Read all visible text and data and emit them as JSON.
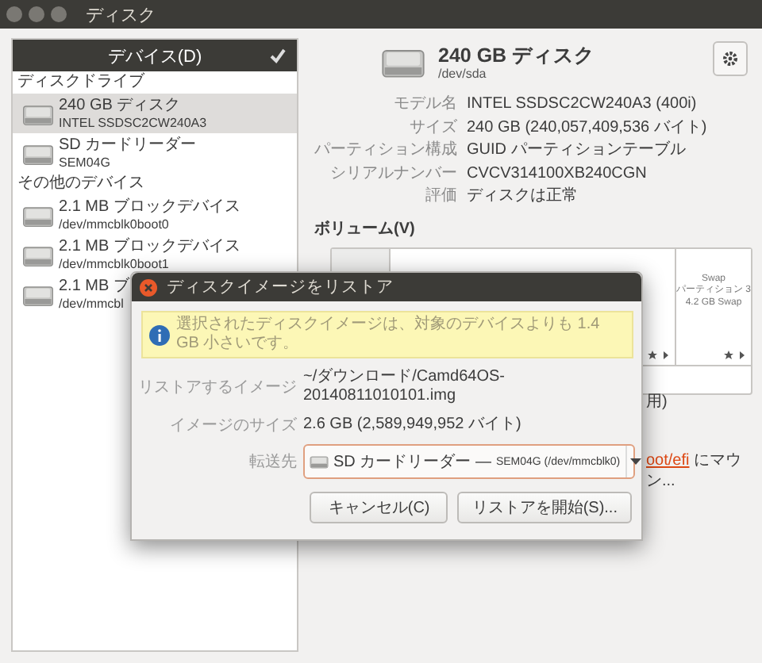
{
  "window": {
    "title": "ディスク"
  },
  "sidebar": {
    "title": "デバイス(D)",
    "groups": [
      {
        "heading": "ディスクドライブ",
        "items": [
          {
            "name": "240 GB ディスク",
            "detail": "INTEL SSDSC2CW240A3",
            "selected": true
          },
          {
            "name": "SD カードリーダー",
            "detail": "SEM04G",
            "selected": false
          }
        ]
      },
      {
        "heading": "その他のデバイス",
        "items": [
          {
            "name": "2.1 MB ブロックデバイス",
            "detail": "/dev/mmcblk0boot0",
            "selected": false
          },
          {
            "name": "2.1 MB ブロックデバイス",
            "detail": "/dev/mmcblk0boot1",
            "selected": false
          },
          {
            "name": "2.1 MB ブ",
            "detail": "/dev/mmcbl",
            "selected": false
          }
        ]
      }
    ]
  },
  "disk": {
    "title": "240 GB ディスク",
    "device": "/dev/sda",
    "properties": [
      {
        "label": "モデル名",
        "value": "INTEL SSDSC2CW240A3 (400i)"
      },
      {
        "label": "サイズ",
        "value": "240 GB (240,057,409,536 バイト)"
      },
      {
        "label": "パーティション構成",
        "value": "GUID パーティションテーブル"
      },
      {
        "label": "シリアルナンバー",
        "value": "CVCV314100XB240CGN"
      },
      {
        "label": "評価",
        "value": "ディスクは正常"
      }
    ]
  },
  "volumes": {
    "title": "ボリューム(V)",
    "segments": [
      {
        "kind": "shaded"
      },
      {
        "kind": "plain"
      },
      {
        "kind": "plain",
        "lines": [
          "Swap",
          "パーティション 3",
          "4.2 GB Swap"
        ]
      }
    ],
    "partial_usage": "用)",
    "mount_link": "oot/efi",
    "mount_text": "にマウン..."
  },
  "dialog": {
    "title": "ディスクイメージをリストア",
    "info": "選択されたディスクイメージは、対象のデバイスよりも 1.4 GB 小さいです。",
    "fields": [
      {
        "label": "リストアするイメージ",
        "value": "~/ダウンロード/Camd64OS-20140811010101.img"
      },
      {
        "label": "イメージのサイズ",
        "value": "2.6 GB (2,589,949,952 バイト)"
      }
    ],
    "destination": {
      "label": "転送先",
      "name": "SD カードリーダー —",
      "detail": "SEM04G (/dev/mmcblk0)"
    },
    "buttons": [
      "キャンセル(C)",
      "リストアを開始(S)..."
    ]
  }
}
